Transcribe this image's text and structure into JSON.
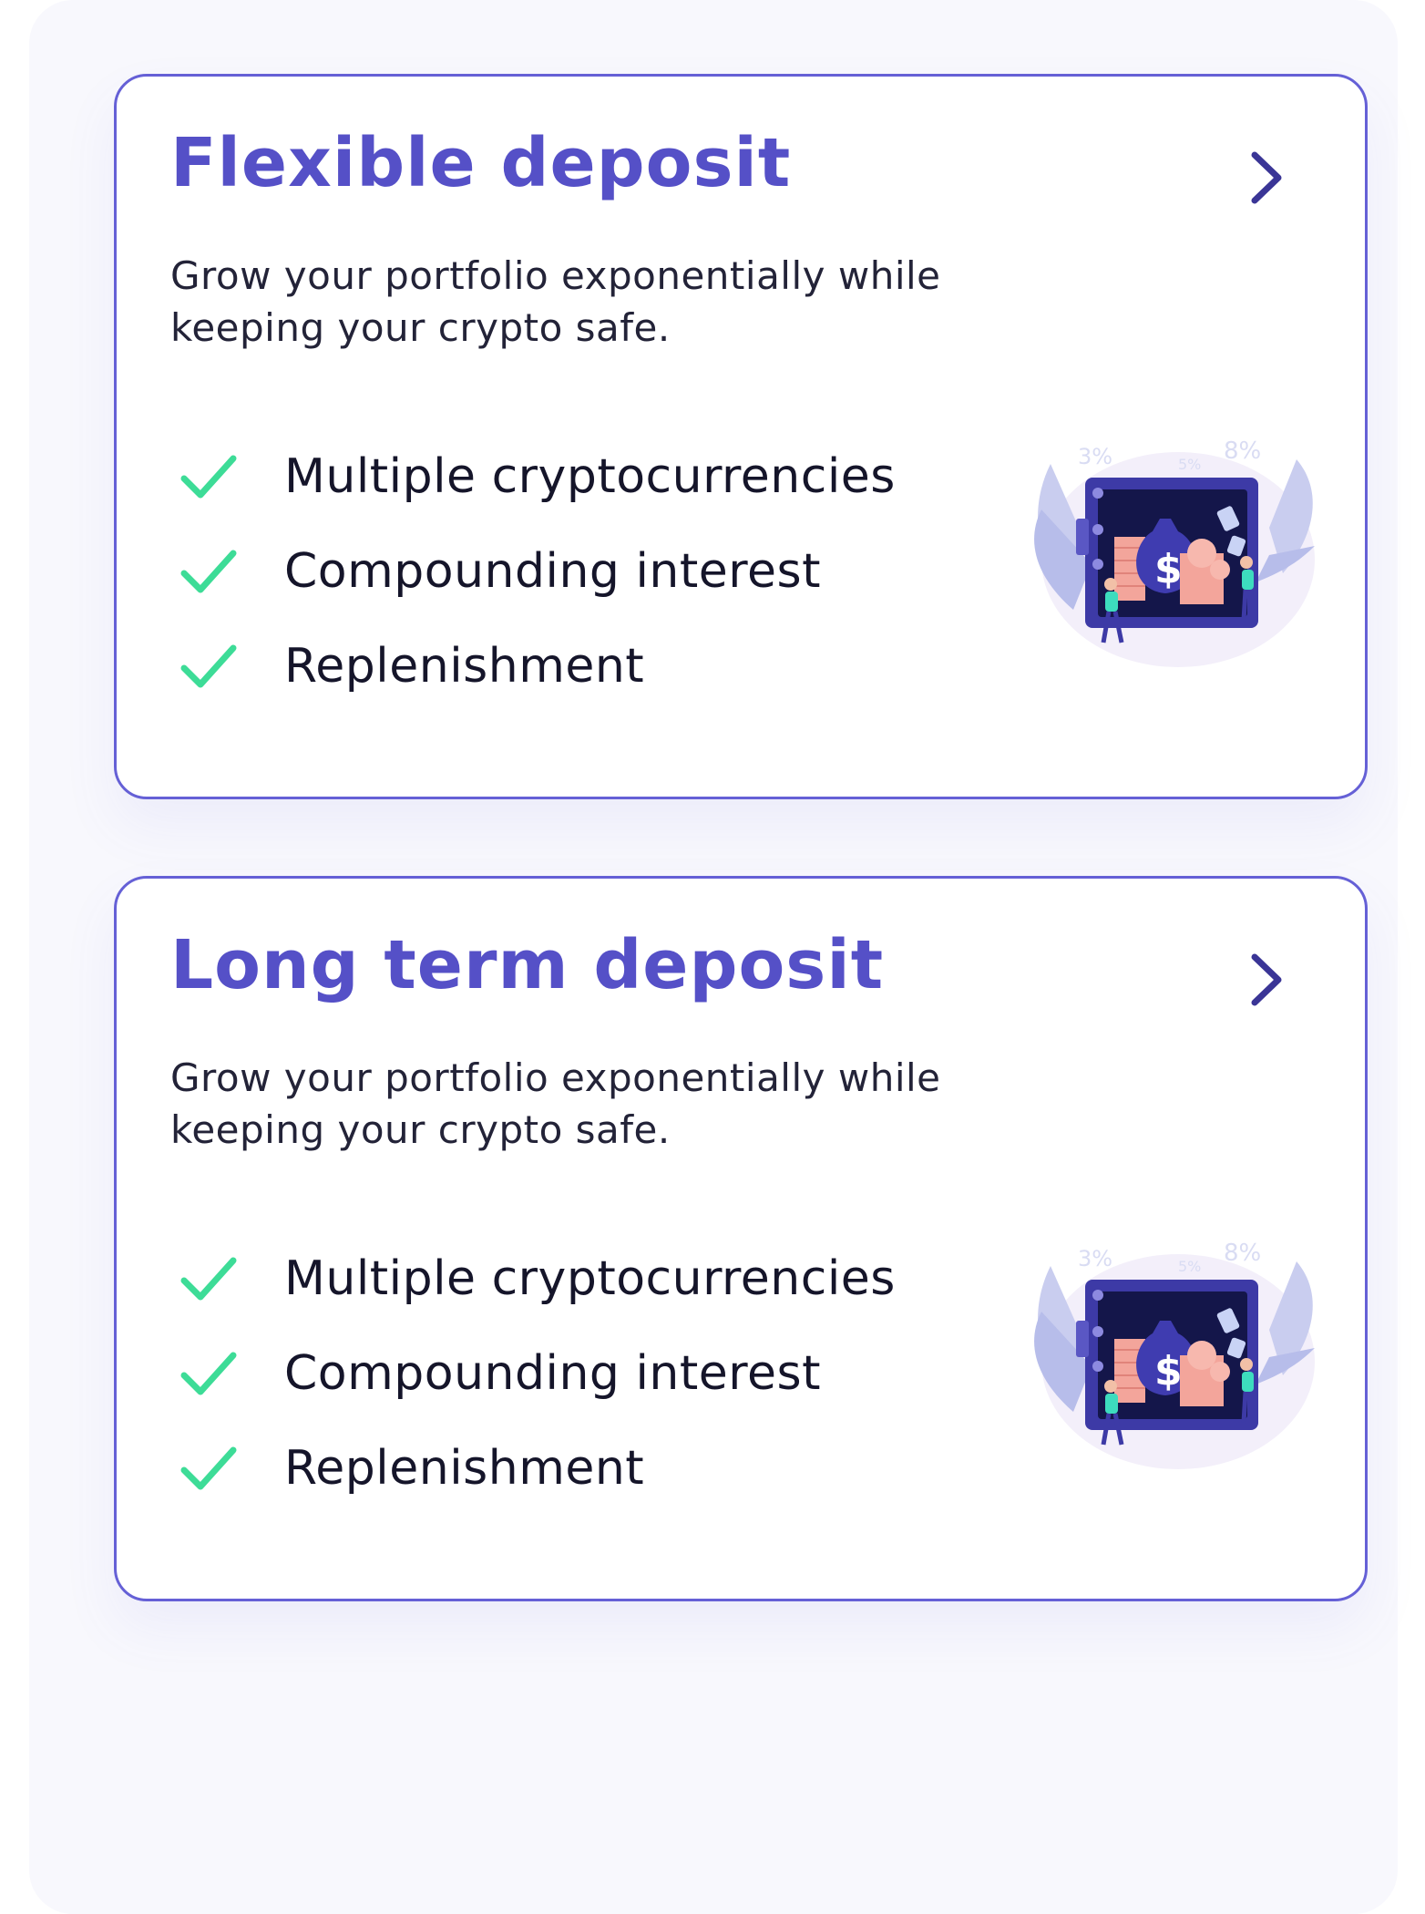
{
  "cards": [
    {
      "title": "Flexible deposit",
      "description": "Grow your portfolio exponentially while keeping your crypto safe.",
      "features": [
        "Multiple cryptocurrencies",
        "Compounding interest",
        "Replenishment"
      ]
    },
    {
      "title": "Long term deposit",
      "description": "Grow your portfolio exponentially while keeping your crypto safe.",
      "features": [
        "Multiple cryptocurrencies",
        "Compounding interest",
        "Replenishment"
      ]
    }
  ],
  "illustration_labels": [
    "3%",
    "5%",
    "8%"
  ],
  "colors": {
    "accent": "#5550c7",
    "border": "#6560d6",
    "check": "#3ddc97",
    "text": "#15152a",
    "background": "#f8f8fd"
  },
  "icons": [
    "chevron-right-icon",
    "check-icon",
    "safe-illustration"
  ]
}
